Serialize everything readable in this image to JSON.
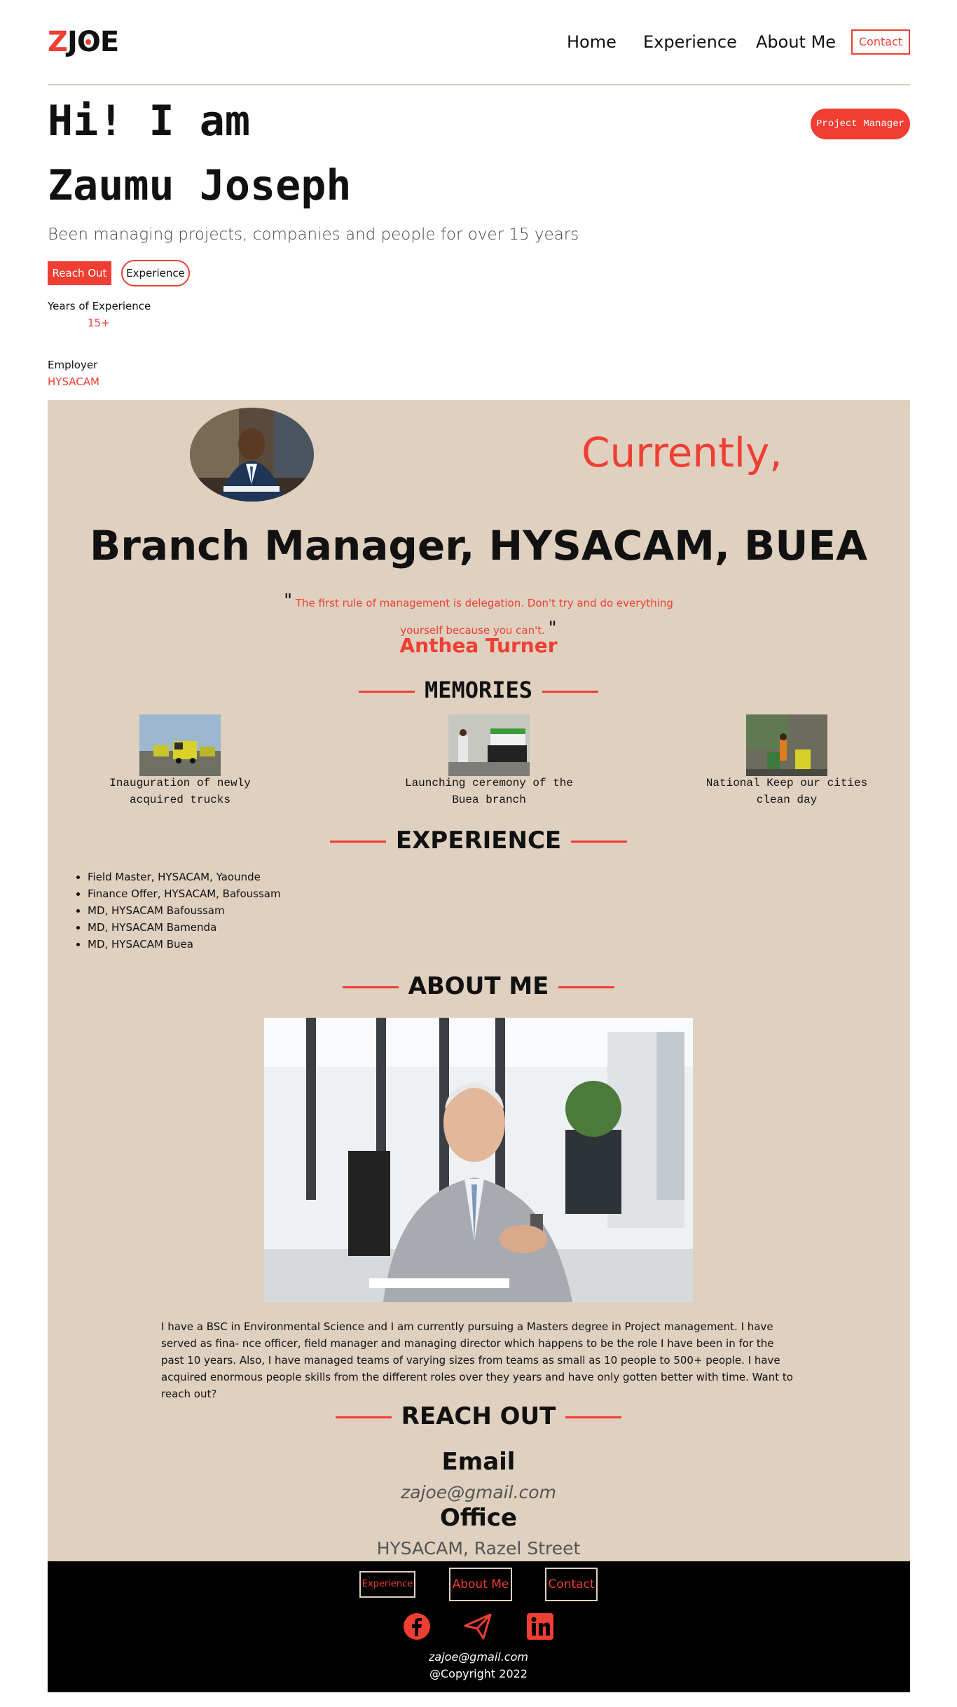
{
  "header": {
    "logo_z": "Z",
    "logo_j": "J",
    "logo_o": "O",
    "logo_e": "E",
    "nav": [
      "Home",
      "Experience",
      "About Me"
    ],
    "contact_label": "Contact"
  },
  "hero": {
    "line1": "Hi! I am",
    "line2": "Zaumu Joseph",
    "role_badge": "Project Manager",
    "subtitle": "Been managing projects, companies and people for over 15 years",
    "reach_out_label": "Reach Out",
    "experience_label": "Experience",
    "years_label": "Years of Experience",
    "years_value": "15+",
    "employer_label": "Employer",
    "employer_value": "HYSACAM"
  },
  "current": {
    "currently": "Currently,",
    "position": "Branch Manager, HYSACAM, BUEA",
    "quote_open": "\"",
    "quote": "The first rule of management is delegation. Don't try and do everything yourself because you can't.",
    "quote_close": "\"",
    "author": "Anthea Turner"
  },
  "memories": {
    "title": "MEMORIES",
    "items": [
      {
        "caption": "Inauguration of newly acquired trucks"
      },
      {
        "caption": "Launching ceremony of the Buea branch"
      },
      {
        "caption": "National Keep our cities clean day"
      }
    ]
  },
  "experience": {
    "title": "EXPERIENCE",
    "items": [
      "Field Master, HYSACAM, Yaounde",
      "Finance Offer, HYSACAM, Bafoussam",
      "MD, HYSACAM Bafoussam",
      "MD, HYSACAM Bamenda",
      "MD, HYSACAM Buea"
    ]
  },
  "about": {
    "title": "ABOUT ME",
    "text": "I have a BSC in Environmental Science and I am currently pursuing a Masters degree in Project management. I have served as fina- nce officer, field manager and managing director which happens to be the role I have been in for the past 10 years. Also, I have managed teams of varying sizes from teams as small as 10 people to 500+ people. I have acquired enormous people skills from the different roles over they years and have only gotten better with time. Want to reach out?"
  },
  "reach": {
    "title": "REACH OUT",
    "email_label": "Email",
    "email_value": "zajoe@gmail.com",
    "office_label": "Office",
    "office_value": "HYSACAM, Razel Street"
  },
  "footer": {
    "links": [
      "Experience",
      "About Me",
      "Contact"
    ],
    "social_icons": [
      "facebook-icon",
      "telegram-icon",
      "linkedin-icon"
    ],
    "email": "zajoe@gmail.com",
    "copyright": "@Copyright 2022"
  },
  "colors": {
    "accent": "#f03e33",
    "section_bg": "#dfd0bf",
    "footer_bg": "#000000"
  }
}
